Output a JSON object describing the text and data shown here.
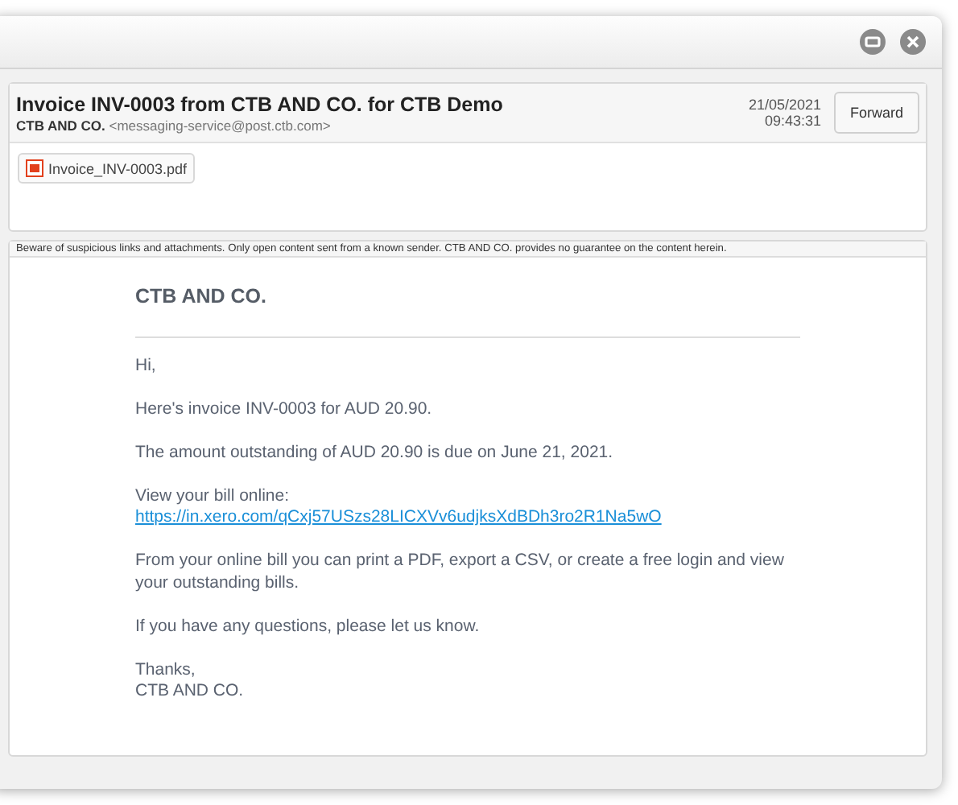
{
  "window": {
    "buttons": [
      {
        "kind": "minimize"
      },
      {
        "kind": "close"
      }
    ]
  },
  "message": {
    "subject": "Invoice INV-0003 from CTB AND CO. for CTB Demo",
    "sender_name": "CTB AND CO.",
    "sender_address": "<messaging-service@post.ctb.com>",
    "date": "21/05/2021",
    "time": "09:43:31",
    "action": "Forward",
    "attachments": [
      {
        "name": "Invoice_INV-0003.pdf"
      }
    ]
  },
  "warning": "Beware of suspicious links and attachments. Only open content sent from a known sender. CTB AND CO. provides no guarantee on the content herein.",
  "body": {
    "company": "CTB AND CO.",
    "paragraphs": [
      {
        "lines": [
          {
            "kind": "text",
            "text": "Hi,"
          }
        ]
      },
      {
        "lines": [
          {
            "kind": "text",
            "text": "Here's invoice INV-0003 for AUD 20.90."
          }
        ]
      },
      {
        "lines": [
          {
            "kind": "text",
            "text": "The amount outstanding of AUD 20.90 is due on June 21, 2021."
          }
        ]
      },
      {
        "lines": [
          {
            "kind": "text",
            "text": "View your bill online:"
          },
          {
            "kind": "link",
            "text": "https://in.xero.com/qCxj57USzs28LICXVv6udjksXdBDh3ro2R1Na5wO"
          }
        ]
      },
      {
        "lines": [
          {
            "kind": "text",
            "text": "From your online bill you can print a PDF, export a CSV, or create a free login and view your outstanding bills."
          }
        ]
      },
      {
        "lines": [
          {
            "kind": "text",
            "text": "If you have any questions, please let us know."
          }
        ]
      },
      {
        "lines": [
          {
            "kind": "text",
            "text": "Thanks,"
          },
          {
            "kind": "text",
            "text": "CTB AND CO."
          }
        ]
      }
    ]
  }
}
